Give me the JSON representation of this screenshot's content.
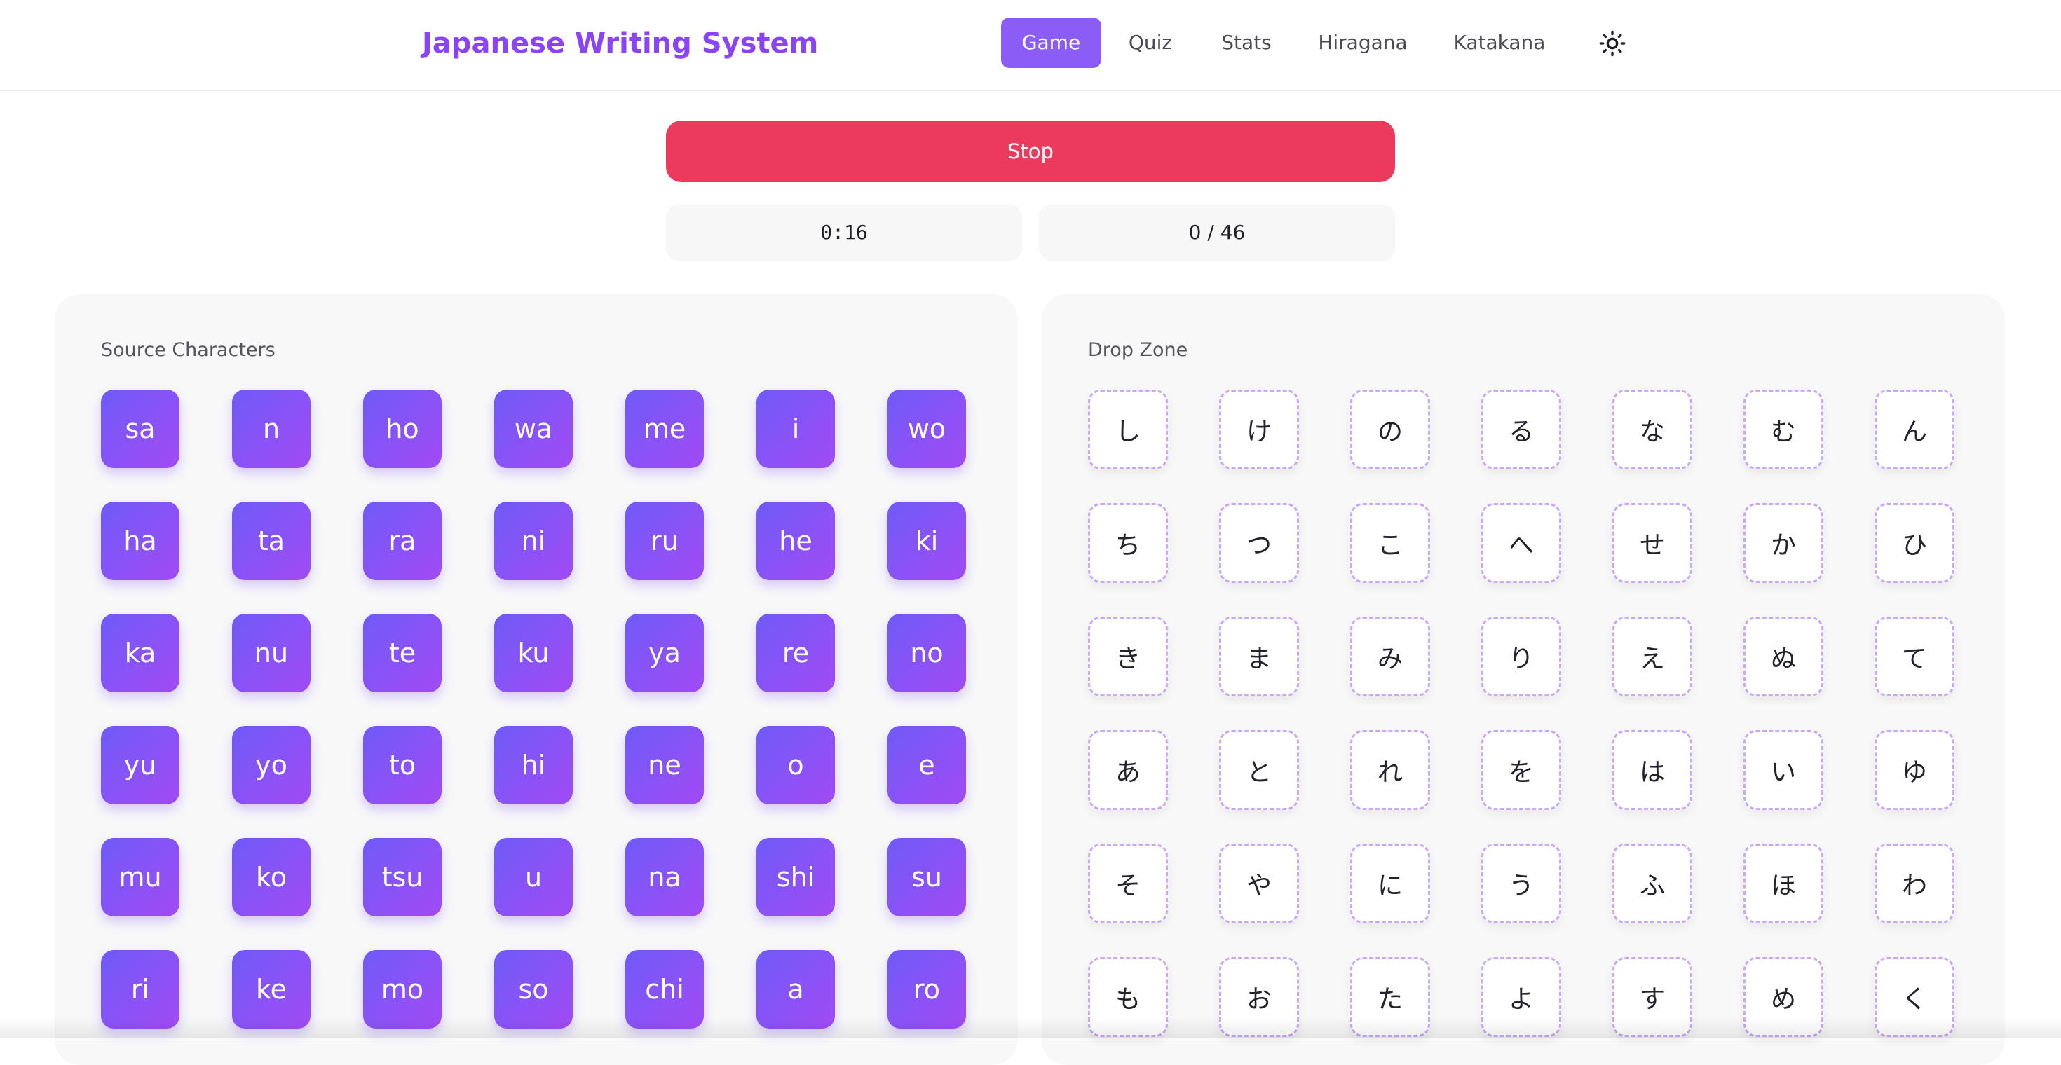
{
  "header": {
    "title": "Japanese Writing System",
    "nav": [
      {
        "label": "Game",
        "active": true
      },
      {
        "label": "Quiz",
        "active": false
      },
      {
        "label": "Stats",
        "active": false
      },
      {
        "label": "Hiragana",
        "active": false
      },
      {
        "label": "Katakana",
        "active": false
      }
    ],
    "theme_toggle_icon": "sun-icon"
  },
  "controls": {
    "stop_label": "Stop",
    "timer": "0:16",
    "score": "0 / 46"
  },
  "source_panel": {
    "title": "Source Characters",
    "tiles": [
      "sa",
      "n",
      "ho",
      "wa",
      "me",
      "i",
      "wo",
      "ha",
      "ta",
      "ra",
      "ni",
      "ru",
      "he",
      "ki",
      "ka",
      "nu",
      "te",
      "ku",
      "ya",
      "re",
      "no",
      "yu",
      "yo",
      "to",
      "hi",
      "ne",
      "o",
      "e",
      "mu",
      "ko",
      "tsu",
      "u",
      "na",
      "shi",
      "su",
      "ri",
      "ke",
      "mo",
      "so",
      "chi",
      "a",
      "ro"
    ]
  },
  "drop_panel": {
    "title": "Drop Zone",
    "tiles": [
      "し",
      "け",
      "の",
      "る",
      "な",
      "む",
      "ん",
      "ち",
      "つ",
      "こ",
      "へ",
      "せ",
      "か",
      "ひ",
      "き",
      "ま",
      "み",
      "り",
      "え",
      "ぬ",
      "て",
      "あ",
      "と",
      "れ",
      "を",
      "は",
      "い",
      "ゆ",
      "そ",
      "や",
      "に",
      "う",
      "ふ",
      "ほ",
      "わ",
      "も",
      "お",
      "た",
      "よ",
      "す",
      "め",
      "く"
    ]
  },
  "colors": {
    "brand": "#8b44f5",
    "nav_active": "#8b5cf6",
    "stop": "#ec3a5c",
    "tile_gradient_start": "#6f5af7",
    "tile_gradient_end": "#a24af3",
    "drop_border": "#c9a8f5"
  }
}
